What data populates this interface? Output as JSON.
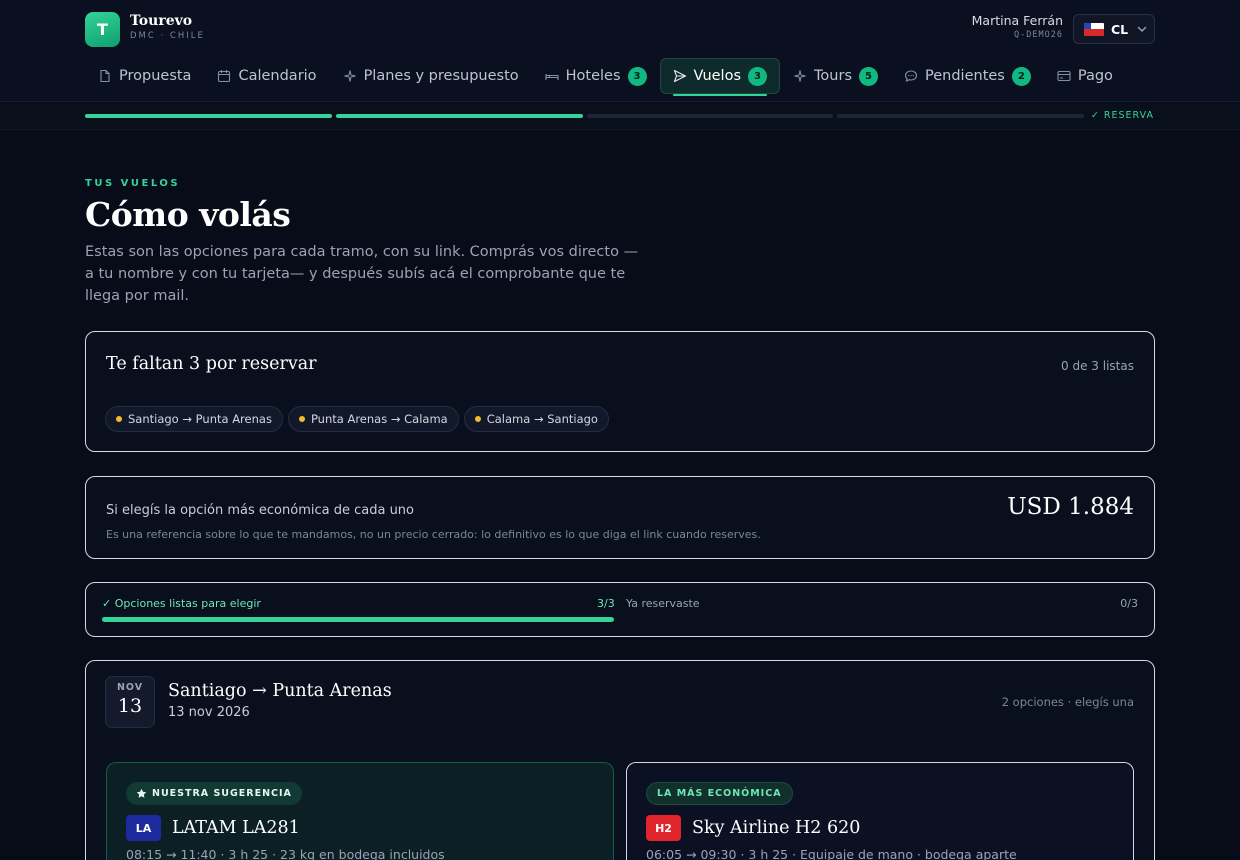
{
  "brand": {
    "logo_letter": "T",
    "name": "Tourevo",
    "subtitle": "DMC · CHILE"
  },
  "user": {
    "name": "Martina Ferrán",
    "code": "Q-DEMO26"
  },
  "country": {
    "code": "CL"
  },
  "nav": [
    {
      "label": "Propuesta",
      "icon": "document-icon"
    },
    {
      "label": "Calendario",
      "icon": "calendar-icon"
    },
    {
      "label": "Planes y presupuesto",
      "icon": "sparkle-icon"
    },
    {
      "label": "Hoteles",
      "icon": "bed-icon",
      "badge": "3"
    },
    {
      "label": "Vuelos",
      "icon": "send-icon",
      "badge": "3",
      "active": true
    },
    {
      "label": "Tours",
      "icon": "sparkle-icon",
      "badge": "5"
    },
    {
      "label": "Pendientes",
      "icon": "chat-icon",
      "badge": "2"
    },
    {
      "label": "Pago",
      "icon": "card-icon"
    }
  ],
  "progress": {
    "segments_total": 4,
    "segments_done": 2,
    "label": "✓ RESERVA"
  },
  "intro": {
    "eyebrow": "TUS VUELOS",
    "title": "Cómo volás",
    "text": "Estas son las opciones para cada tramo, con su link. Comprás vos directo —a tu nombre y con tu tarjeta— y después subís acá el comprobante que te llega por mail."
  },
  "pending": {
    "title": "Te faltan 3 por reservar",
    "count": "0 de 3 listas",
    "legs": [
      "Santiago → Punta Arenas",
      "Punta Arenas → Calama",
      "Calama → Santiago"
    ]
  },
  "estimate": {
    "label": "Si elegís la opción más económica de cada uno",
    "note": "Es una referencia sobre lo que te mandamos, no un precio cerrado: lo definitivo es lo que diga el link cuando reserves.",
    "amount": "USD 1.884"
  },
  "status": {
    "ready_label": "✓ Opciones listas para elegir",
    "ready_count": "3/3",
    "ready_fraction": 1,
    "booked_label": "Ya reservaste",
    "booked_count": "0/3"
  },
  "leg": {
    "month": "NOV",
    "day": "13",
    "origin": "Santiago",
    "arrow": "→",
    "destination": "Punta Arenas",
    "date": "13 nov 2026",
    "options_note": "2 opciones · elegís una",
    "options": [
      {
        "tag": "NUESTRA SUGERENCIA",
        "airline_code": "LA",
        "airline_color": "#1c2a9e",
        "flight": "LATAM LA281",
        "details": "08:15 → 11:40 · 3 h 25 · 23 kg en bodega incluidos"
      },
      {
        "tag": "LA MÁS ECONÓMICA",
        "airline_code": "H2",
        "airline_color": "#e0242b",
        "flight": "Sky Airline H2 620",
        "details": "06:05 → 09:30 · 3 h 25 · Equipaje de mano · bodega aparte"
      }
    ]
  },
  "colors": {
    "accent": "#34d399",
    "pending_dot": "#f5b82e",
    "background": "#080c18"
  }
}
